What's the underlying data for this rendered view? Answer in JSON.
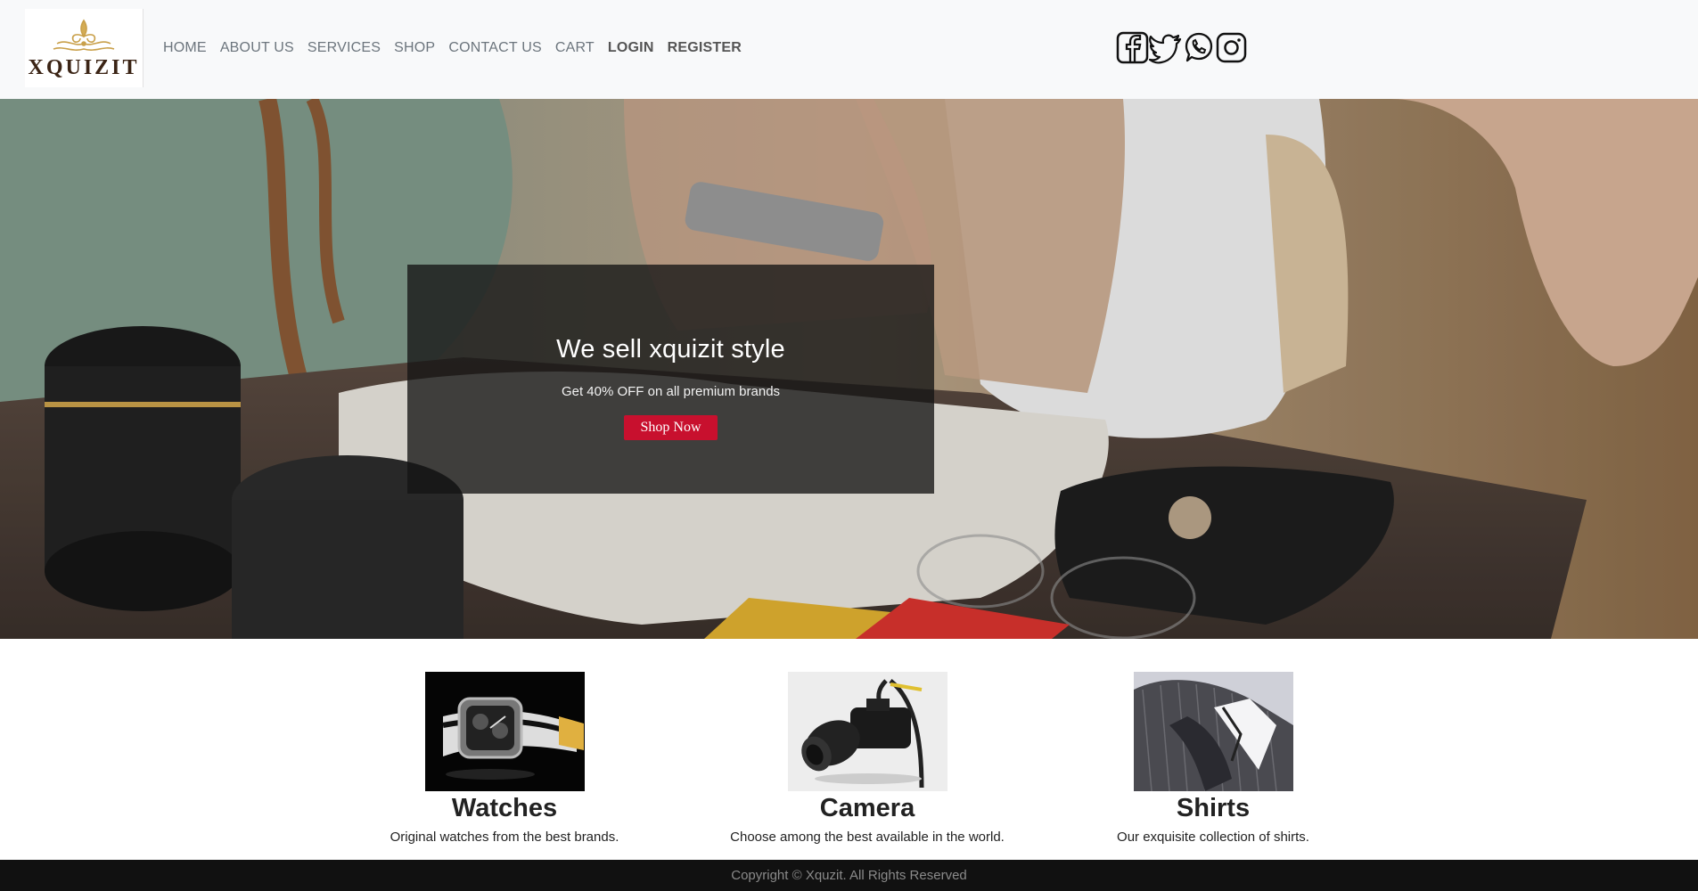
{
  "brand": {
    "name": "XQUIZIT"
  },
  "nav": {
    "links": [
      "HOME",
      "ABOUT US",
      "SERVICES",
      "SHOP",
      "CONTACT US",
      "CART"
    ],
    "login": "LOGIN",
    "register": "REGISTER"
  },
  "social": [
    "facebook-icon",
    "twitter-icon",
    "whatsapp-icon",
    "instagram-icon"
  ],
  "hero": {
    "title": "We sell xquizit style",
    "subtitle": "Get 40% OFF on all premium brands",
    "button": "Shop Now",
    "accent": "#c8102e"
  },
  "products": [
    {
      "title": "Watches",
      "description": "Original watches from the best brands."
    },
    {
      "title": "Camera",
      "description": "Choose among the best available in the world."
    },
    {
      "title": "Shirts",
      "description": "Our exquisite collection of shirts."
    }
  ],
  "footer": {
    "text": "Copyright © Xquzit. All Rights Reserved"
  }
}
